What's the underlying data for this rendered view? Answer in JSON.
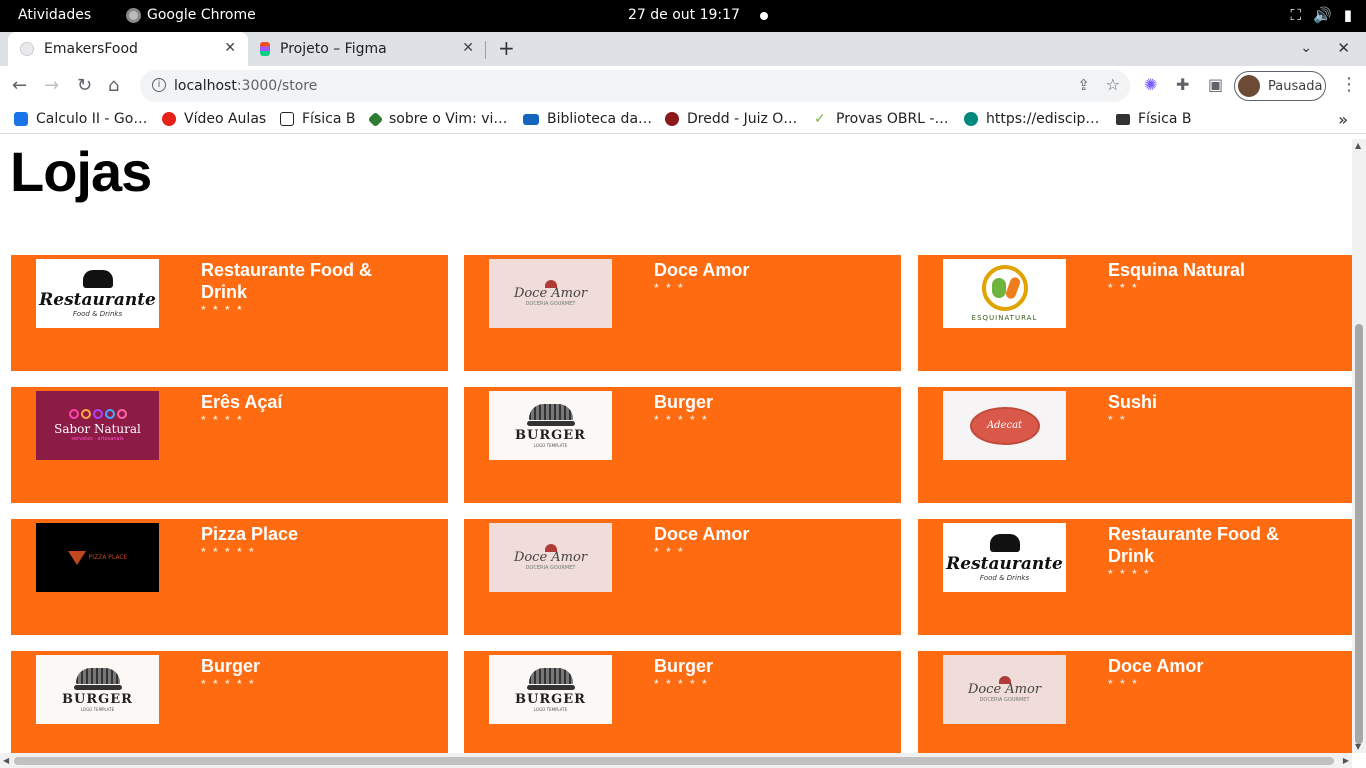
{
  "os_bar": {
    "activities": "Atividades",
    "app_name": "Google Chrome",
    "clock": "27 de out  19:17"
  },
  "tabs": [
    {
      "title": "EmakersFood",
      "active": true
    },
    {
      "title": "Projeto – Figma",
      "active": false
    }
  ],
  "address": {
    "host": "localhost",
    "path": ":3000/store"
  },
  "profile": {
    "label": "Pausada"
  },
  "bookmarks": [
    {
      "label": "Calculo II - Go…",
      "icon": "google-drive-icon",
      "color": "#1a73e8"
    },
    {
      "label": "Vídeo Aulas",
      "icon": "youtube-icon",
      "color": "#e62117"
    },
    {
      "label": "Física B",
      "icon": "notion-icon",
      "color": "#222222"
    },
    {
      "label": "sobre o Vim: vi…",
      "icon": "vim-icon",
      "color": "#2e7d32"
    },
    {
      "label": "Biblioteca da…",
      "icon": "library-icon",
      "color": "#1565c0"
    },
    {
      "label": "Dredd - Juiz O…",
      "icon": "dredd-icon",
      "color": "#8b1a1a"
    },
    {
      "label": "Provas OBRL -…",
      "icon": "check-icon",
      "color": "#7cb342"
    },
    {
      "label": "https://edisci​p…",
      "icon": "edisciplinas-icon",
      "color": "#00897b"
    },
    {
      "label": "Física B",
      "icon": "folder-icon",
      "color": "#333333"
    }
  ],
  "page": {
    "title": "Lojas",
    "stores": [
      {
        "name": "Restaurante Food & Drink",
        "stars": "* * * *",
        "logo": "restaurante"
      },
      {
        "name": "Doce Amor",
        "stars": "* * *",
        "logo": "doce"
      },
      {
        "name": "Esquina Natural",
        "stars": "* * *",
        "logo": "esquina"
      },
      {
        "name": "Erês Açaí",
        "stars": "* * * *",
        "logo": "sabor"
      },
      {
        "name": "Burger",
        "stars": "* * * * *",
        "logo": "burger"
      },
      {
        "name": "Sushi",
        "stars": "* *",
        "logo": "sushi"
      },
      {
        "name": "Pizza Place",
        "stars": "* * * * *",
        "logo": "pizza"
      },
      {
        "name": "Doce Amor",
        "stars": "* * *",
        "logo": "doce"
      },
      {
        "name": "Restaurante Food & Drink",
        "stars": "* * * *",
        "logo": "restaurante"
      },
      {
        "name": "Burger",
        "stars": "* * * * *",
        "logo": "burger"
      },
      {
        "name": "Burger",
        "stars": "* * * * *",
        "logo": "burger"
      },
      {
        "name": "Doce Amor",
        "stars": "* * *",
        "logo": "doce"
      }
    ]
  },
  "logo_text": {
    "restaurante": {
      "main": "Restaurante",
      "sub": "Food & Drinks"
    },
    "doce": {
      "main": "Doce Amor",
      "sub": "DOCERIA GOURMET"
    },
    "esquina": {
      "main": "ESQUINATURAL"
    },
    "sabor": {
      "main": "Sabor Natural",
      "sub": "sorvetes · artesanais"
    },
    "burger": {
      "main": "BURGER",
      "sub": "LOGO TEMPLATE"
    },
    "sushi": {
      "main": "Adecat"
    },
    "pizza": {
      "main": "PIZZA PLACE"
    }
  },
  "colors": {
    "card_background": "#ff6b10",
    "card_text": "#ffffff"
  }
}
